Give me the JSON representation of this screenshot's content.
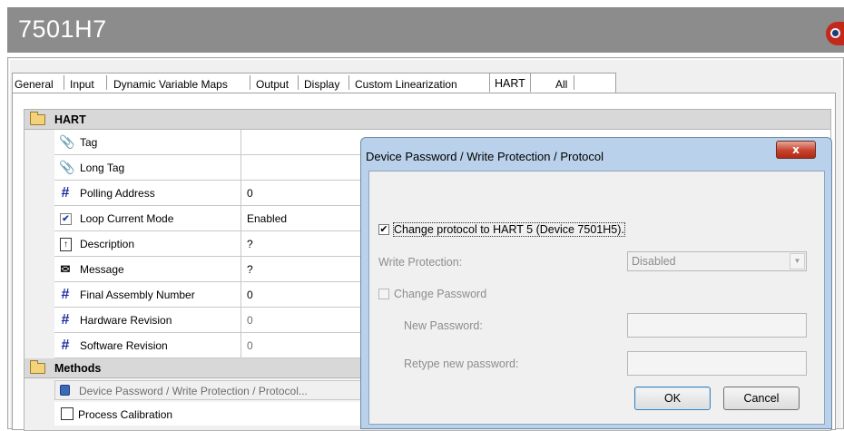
{
  "window": {
    "title": "7501H7",
    "colors": {
      "banner": "#8c8c8c",
      "panel": "#f0f0f0",
      "dialog_frame": "#b9d1ea",
      "close_button": "#c7432e",
      "hash_icon": "#1a2a9e"
    }
  },
  "tabs": [
    {
      "label": "General",
      "active": false
    },
    {
      "label": "Input",
      "active": false
    },
    {
      "label": "Dynamic Variable Maps",
      "active": false
    },
    {
      "label": "Output",
      "active": false
    },
    {
      "label": "Display",
      "active": false
    },
    {
      "label": "Custom Linearization",
      "active": false
    },
    {
      "label": "HART",
      "active": true
    },
    {
      "label": "All",
      "active": false
    }
  ],
  "grid": {
    "category_hart": "HART",
    "rows": [
      {
        "icon": "paperclip-icon",
        "name": "Tag",
        "value": ""
      },
      {
        "icon": "paperclip-icon",
        "name": "Long Tag",
        "value": ""
      },
      {
        "icon": "hash-icon",
        "name": "Polling Address",
        "value": "0"
      },
      {
        "icon": "checkbox-icon",
        "name": "Loop Current Mode",
        "value": "Enabled"
      },
      {
        "icon": "description-icon",
        "name": "Description",
        "value": "?"
      },
      {
        "icon": "envelope-icon",
        "name": "Message",
        "value": "?"
      },
      {
        "icon": "hash-icon",
        "name": "Final Assembly Number",
        "value": "0"
      },
      {
        "icon": "hash-icon",
        "name": "Hardware Revision",
        "value": "0"
      },
      {
        "icon": "hash-icon",
        "name": "Software Revision",
        "value": "0"
      }
    ],
    "category_methods": "Methods",
    "methods": [
      {
        "icon": "lock-icon",
        "label": "Device Password / Write Protection / Protocol..."
      },
      {
        "icon": "process-calibration-icon",
        "label": "Process Calibration"
      }
    ]
  },
  "dialog": {
    "title": "Device Password / Write Protection / Protocol",
    "close_glyph": "x",
    "change_protocol": {
      "label": "Change protocol to HART 5 (Device 7501H5).",
      "checked": true
    },
    "write_protection": {
      "label": "Write Protection:",
      "value": "Disabled"
    },
    "change_password": {
      "label": "Change Password",
      "checked": false
    },
    "new_password": {
      "label": "New Password:",
      "value": ""
    },
    "retype_password": {
      "label": "Retype new password:",
      "value": ""
    },
    "ok_label": "OK",
    "cancel_label": "Cancel"
  }
}
